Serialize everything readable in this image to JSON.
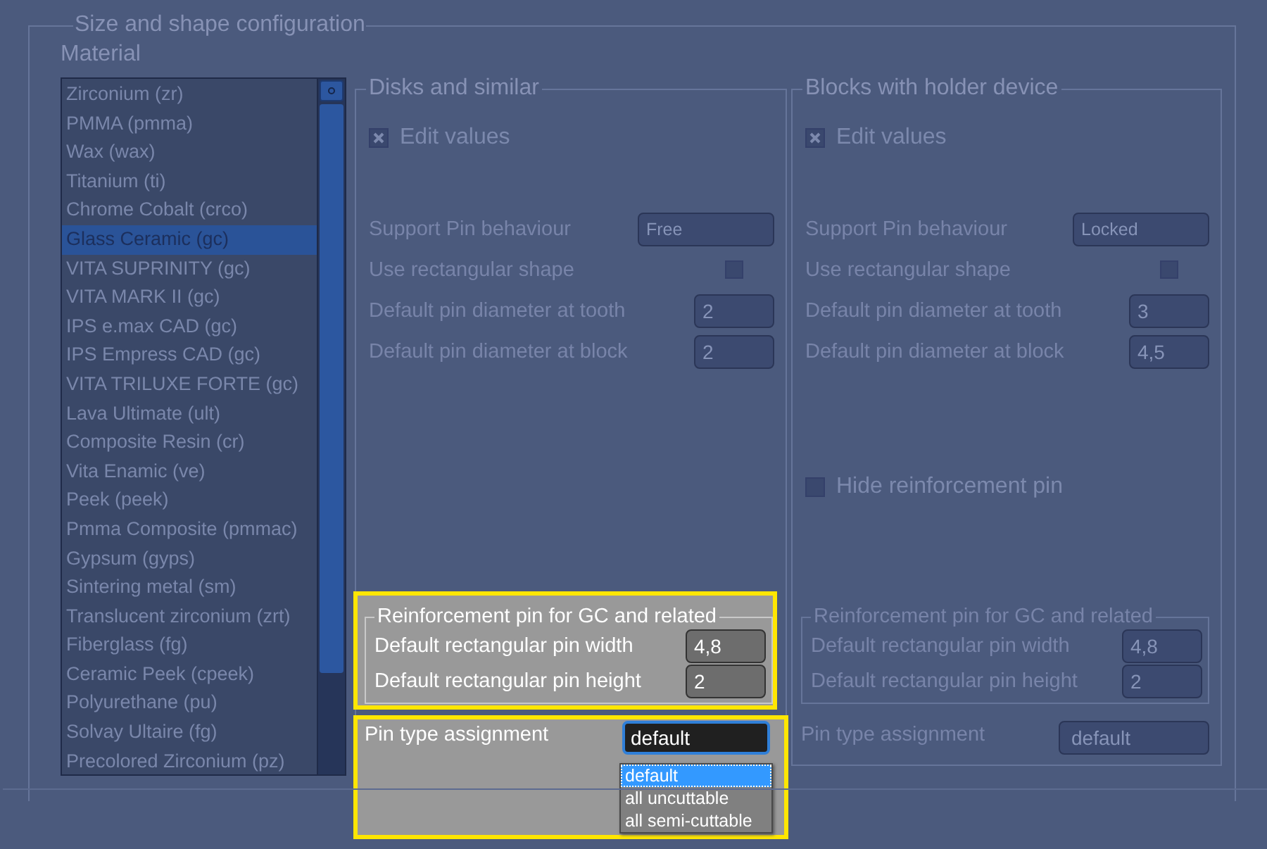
{
  "group_title": "Size and shape configuration",
  "material": {
    "label": "Material",
    "items": [
      {
        "label": "Zirconium (zr)",
        "selected": false
      },
      {
        "label": "PMMA (pmma)",
        "selected": false
      },
      {
        "label": "Wax (wax)",
        "selected": false
      },
      {
        "label": "Titanium (ti)",
        "selected": false
      },
      {
        "label": "Chrome Cobalt (crco)",
        "selected": false
      },
      {
        "label": "Glass Ceramic (gc)",
        "selected": true
      },
      {
        "label": "VITA SUPRINITY (gc)",
        "selected": false
      },
      {
        "label": "VITA MARK II (gc)",
        "selected": false
      },
      {
        "label": "IPS e.max CAD (gc)",
        "selected": false
      },
      {
        "label": "IPS Empress CAD (gc)",
        "selected": false
      },
      {
        "label": "VITA TRILUXE FORTE (gc)",
        "selected": false
      },
      {
        "label": "Lava Ultimate (ult)",
        "selected": false
      },
      {
        "label": "Composite Resin (cr)",
        "selected": false
      },
      {
        "label": "Vita Enamic (ve)",
        "selected": false
      },
      {
        "label": "Peek (peek)",
        "selected": false
      },
      {
        "label": "Pmma Composite (pmmac)",
        "selected": false
      },
      {
        "label": "Gypsum (gyps)",
        "selected": false
      },
      {
        "label": "Sintering metal (sm)",
        "selected": false
      },
      {
        "label": "Translucent zirconium (zrt)",
        "selected": false
      },
      {
        "label": "Fiberglass (fg)",
        "selected": false
      },
      {
        "label": "Ceramic Peek (cpeek)",
        "selected": false
      },
      {
        "label": "Polyurethane (pu)",
        "selected": false
      },
      {
        "label": "Solvay Ultaire (fg)",
        "selected": false
      },
      {
        "label": "Precolored Zirconium (pz)",
        "selected": false
      }
    ]
  },
  "panels": [
    {
      "title": "Disks and similar",
      "edit_values": {
        "label": "Edit values",
        "checked": true
      },
      "rows": [
        {
          "kind": "dropdown",
          "label": "Support Pin behaviour",
          "value": "Free"
        },
        {
          "kind": "checkbox",
          "label": "Use rectangular shape",
          "checked": false
        },
        {
          "kind": "number",
          "label": "Default pin diameter at tooth",
          "value": "2"
        },
        {
          "kind": "number",
          "label": "Default pin diameter at block",
          "value": "2"
        }
      ],
      "reinforcement": {
        "title": "Reinforcement pin for GC and related",
        "highlighted": true,
        "rows": [
          {
            "label": "Default rectangular pin width",
            "value": "4,8"
          },
          {
            "label": "Default rectangular pin height",
            "value": "2"
          }
        ]
      },
      "pin_type": {
        "label": "Pin type assignment",
        "value": "default",
        "highlighted": true,
        "open": true,
        "options": [
          {
            "label": "default",
            "selected": true
          },
          {
            "label": "all uncuttable",
            "selected": false
          },
          {
            "label": "all semi-cuttable",
            "selected": false
          }
        ]
      }
    },
    {
      "title": "Blocks with holder device",
      "edit_values": {
        "label": "Edit values",
        "checked": true
      },
      "rows": [
        {
          "kind": "dropdown",
          "label": "Support Pin behaviour",
          "value": "Locked"
        },
        {
          "kind": "checkbox",
          "label": "Use rectangular shape",
          "checked": false
        },
        {
          "kind": "number",
          "label": "Default pin diameter at tooth",
          "value": "3"
        },
        {
          "kind": "number",
          "label": "Default pin diameter at block",
          "value": "4,5"
        }
      ],
      "hide_reinforcement": {
        "label": "Hide reinforcement pin",
        "checked": false
      },
      "reinforcement": {
        "title": "Reinforcement pin for GC and related",
        "highlighted": false,
        "rows": [
          {
            "label": "Default rectangular pin width",
            "value": "4,8"
          },
          {
            "label": "Default rectangular pin height",
            "value": "2"
          }
        ]
      },
      "pin_type": {
        "label": "Pin type assignment",
        "value": "default",
        "highlighted": false,
        "open": false
      }
    }
  ]
}
